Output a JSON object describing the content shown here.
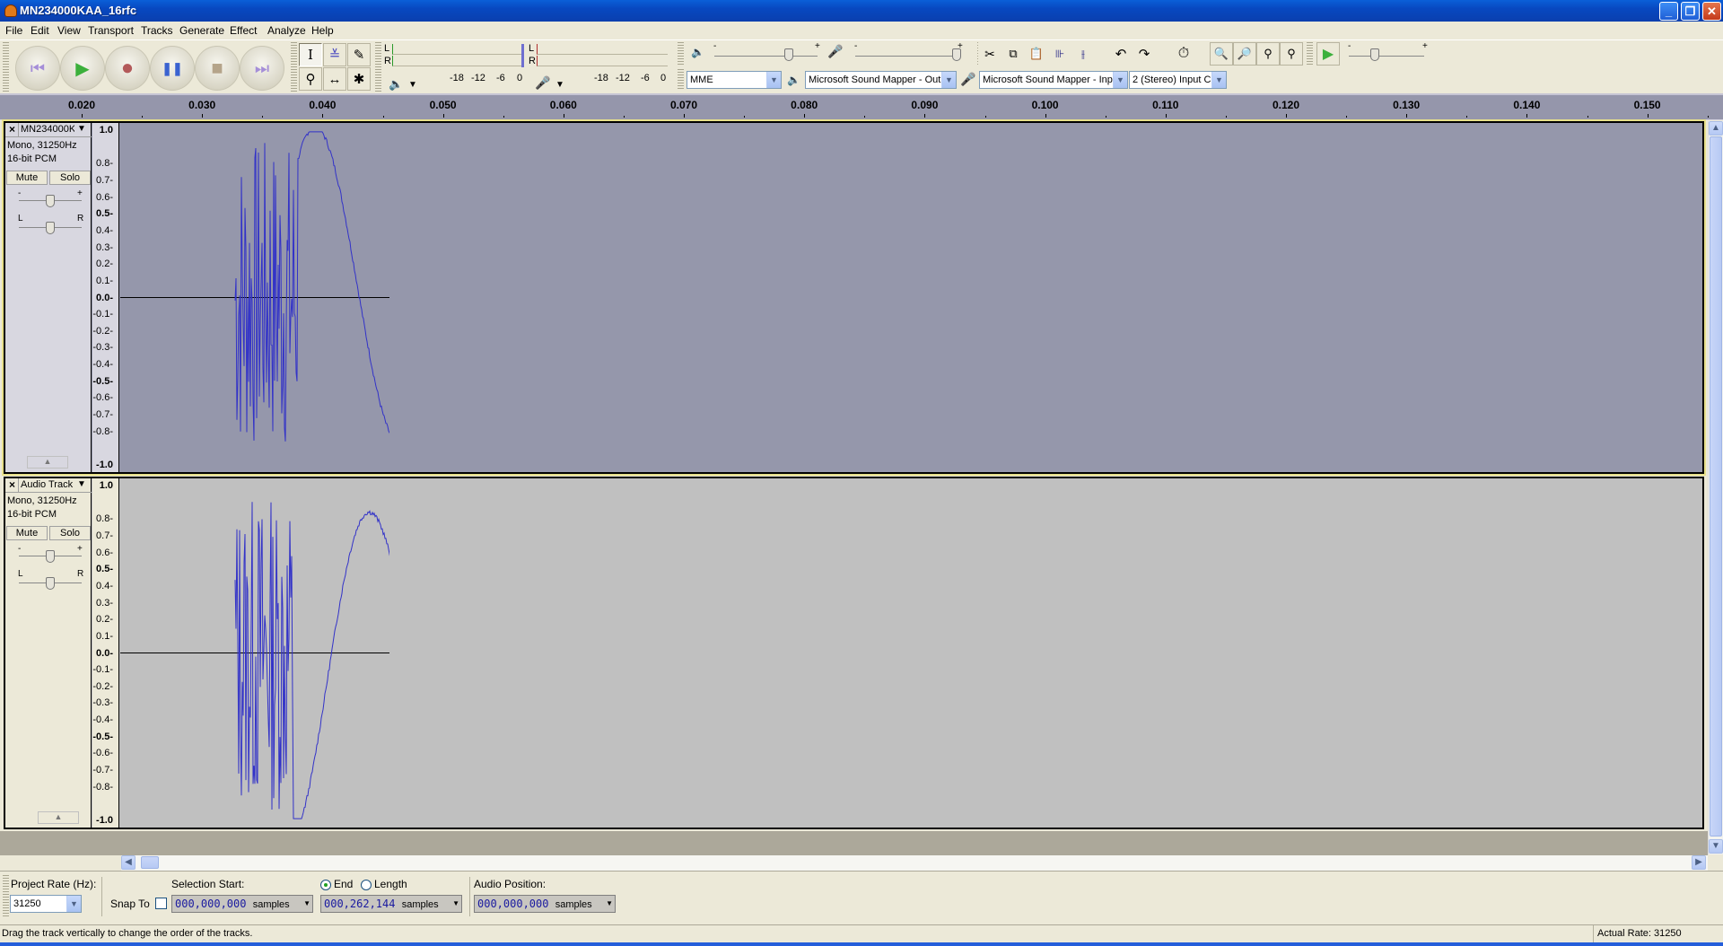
{
  "window": {
    "title": "MN234000KAA_16rfc",
    "minimize": "_",
    "restore": "❐",
    "close": "✕"
  },
  "menu": [
    "File",
    "Edit",
    "View",
    "Transport",
    "Tracks",
    "Generate",
    "Effect",
    "Analyze",
    "Help"
  ],
  "transport": {
    "skip_start": "⏮",
    "play": "▶",
    "record": "●",
    "pause": "❚❚",
    "stop": "■",
    "skip_end": "⏭"
  },
  "tools": {
    "select": "I",
    "envelope": "≚",
    "draw": "✎",
    "zoom": "⚲",
    "timeshift": "↔",
    "multi": "✱"
  },
  "meters": {
    "play_ticks": [
      "-18",
      "-12",
      "-6",
      "0"
    ],
    "rec_ticks": [
      "-18",
      "-12",
      "-6",
      "0"
    ],
    "L": "L",
    "R": "R"
  },
  "mixer": {
    "minus": "-",
    "plus": "+",
    "output_volume": 0.72,
    "input_volume": 0.98
  },
  "edit_tools": [
    "cut",
    "copy",
    "paste",
    "trim",
    "silence",
    "undo",
    "redo",
    "sync-lock",
    "zoom-in",
    "zoom-out",
    "fit-selection",
    "fit-project"
  ],
  "play_at_speed": {
    "minus": "-",
    "plus": "+",
    "speed": 0.35
  },
  "devices": {
    "host": "MME",
    "output": "Microsoft Sound Mapper - Outp",
    "input": "Microsoft Sound Mapper - Inpu",
    "channels": "2 (Stereo) Input C"
  },
  "ruler": {
    "labels": [
      "0.020",
      "0.030",
      "0.040",
      "0.050",
      "0.060",
      "0.070",
      "0.080",
      "0.090",
      "0.100",
      "0.110",
      "0.120",
      "0.130",
      "0.140",
      "0.150"
    ]
  },
  "vscale": {
    "labels": [
      "1.0",
      "0.8",
      "0.7",
      "0.6",
      "0.5",
      "0.4",
      "0.3",
      "0.2",
      "0.1",
      "0.0",
      "-0.1",
      "-0.2",
      "-0.3",
      "-0.4",
      "-0.5",
      "-0.6",
      "-0.7",
      "-0.8",
      "-1.0"
    ]
  },
  "tracks": [
    {
      "name": "MN234000K",
      "format": "Mono, 31250Hz",
      "bits": "16-bit PCM",
      "mute": "Mute",
      "solo": "Solo",
      "gain": 0.5,
      "pan": 0.5,
      "selected": true
    },
    {
      "name": "Audio Track",
      "format": "Mono, 31250Hz",
      "bits": "16-bit PCM",
      "mute": "Mute",
      "solo": "Solo",
      "gain": 0.5,
      "pan": 0.5,
      "selected": false
    }
  ],
  "colors": {
    "waveform": "#3232c8",
    "selected_bg": "#9597ab",
    "unselected_bg": "#c0c0c0",
    "ruler_bg": "#9596ab"
  },
  "selection": {
    "project_rate_label": "Project Rate (Hz):",
    "project_rate": "31250",
    "snap_to": "Snap To",
    "selection_start_label": "Selection Start:",
    "end_label": "End",
    "length_label": "Length",
    "audio_position_label": "Audio Position:",
    "start_value": "000,000,000",
    "end_value": "000,262,144",
    "position_value": "000,000,000",
    "unit": "samples"
  },
  "status": {
    "message": "Drag the track vertically to change the order of the tracks.",
    "rate": "Actual Rate: 31250"
  }
}
